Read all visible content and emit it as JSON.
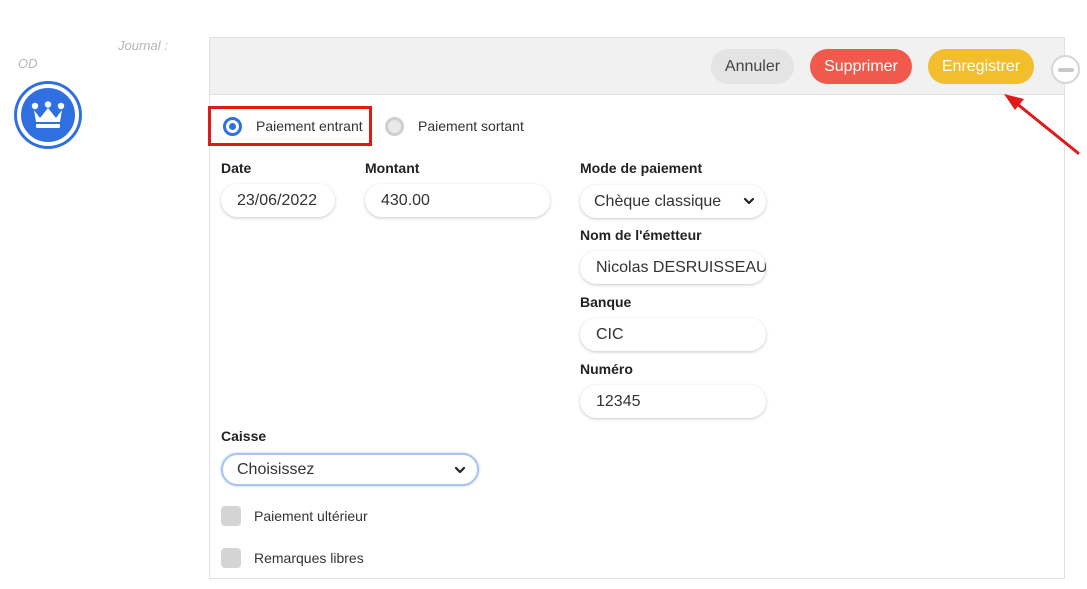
{
  "journal": {
    "label": "Journal :",
    "value": "OD"
  },
  "logo": {
    "icon": "crown-icon",
    "color": "#2f6fe0"
  },
  "toolbar": {
    "cancel_label": "Annuler",
    "delete_label": "Supprimer",
    "save_label": "Enregistrer",
    "collapse_icon": "minus-circle-icon"
  },
  "payment_type": {
    "options": [
      {
        "label": "Paiement entrant",
        "selected": true
      },
      {
        "label": "Paiement sortant",
        "selected": false
      }
    ]
  },
  "form": {
    "date": {
      "label": "Date",
      "value": "23/06/2022"
    },
    "montant": {
      "label": "Montant",
      "value": "430.00"
    },
    "mode_paiement": {
      "label": "Mode de paiement",
      "value": "Chèque classique"
    },
    "nom_emetteur": {
      "label": "Nom de l'émetteur",
      "value": "Nicolas DESRUISSEAUX"
    },
    "banque": {
      "label": "Banque",
      "value": "CIC"
    },
    "numero": {
      "label": "Numéro",
      "value": "12345"
    },
    "caisse": {
      "label": "Caisse",
      "value": "Choisissez"
    },
    "paiement_ulterieur": {
      "label": "Paiement ultérieur",
      "checked": false
    },
    "remarques_libres": {
      "label": "Remarques libres",
      "checked": false
    }
  },
  "colors": {
    "accent": "#2f6fe0",
    "delete": "#ef5a4c",
    "save": "#f2be2e",
    "highlight": "#e01919"
  }
}
